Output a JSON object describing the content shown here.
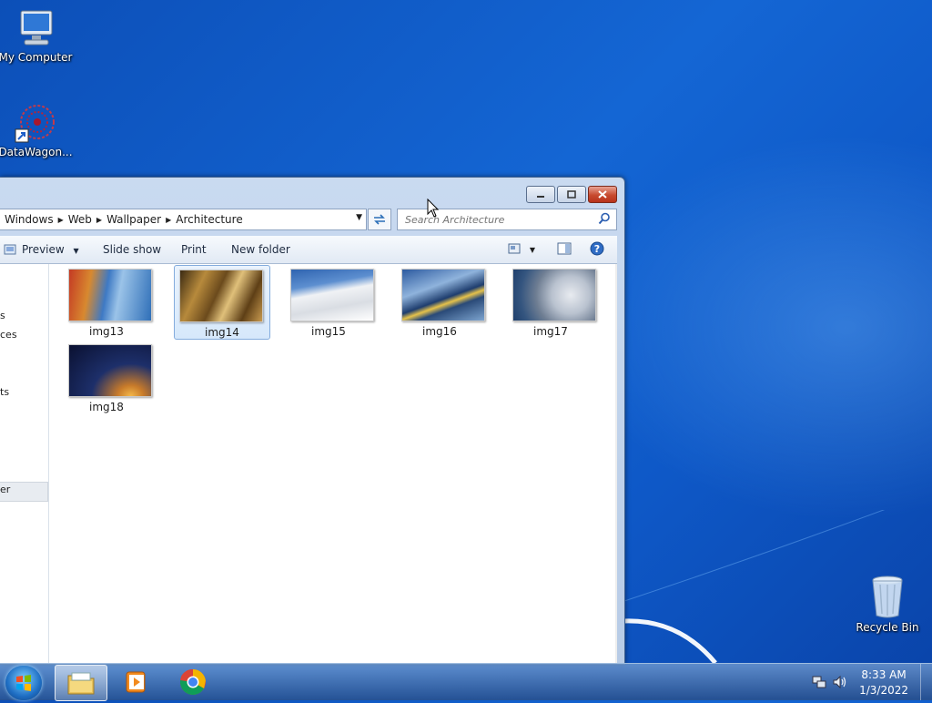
{
  "desktop": {
    "icons": [
      {
        "label": "My Computer",
        "icon": "computer-icon"
      },
      {
        "label": "DataWagon...",
        "icon": "datawagon-icon"
      },
      {
        "label": "Recycle Bin",
        "icon": "recycle-bin-icon"
      }
    ]
  },
  "window": {
    "breadcrumb": [
      "Windows",
      "Web",
      "Wallpaper",
      "Architecture"
    ],
    "search_placeholder": "Search Architecture",
    "toolbar": {
      "preview": "Preview",
      "slideshow": "Slide show",
      "print": "Print",
      "new_folder": "New folder"
    },
    "nav_fragments": [
      "s",
      "ces",
      "ts",
      "er"
    ],
    "files": [
      {
        "name": "img13",
        "selected": false
      },
      {
        "name": "img14",
        "selected": true
      },
      {
        "name": "img15",
        "selected": false
      },
      {
        "name": "img16",
        "selected": false
      },
      {
        "name": "img17",
        "selected": false
      },
      {
        "name": "img18",
        "selected": false
      }
    ]
  },
  "taskbar": {
    "pinned": [
      "windows-explorer-icon",
      "media-player-icon",
      "chrome-icon"
    ],
    "time": "8:33 AM",
    "date": "1/3/2022"
  }
}
